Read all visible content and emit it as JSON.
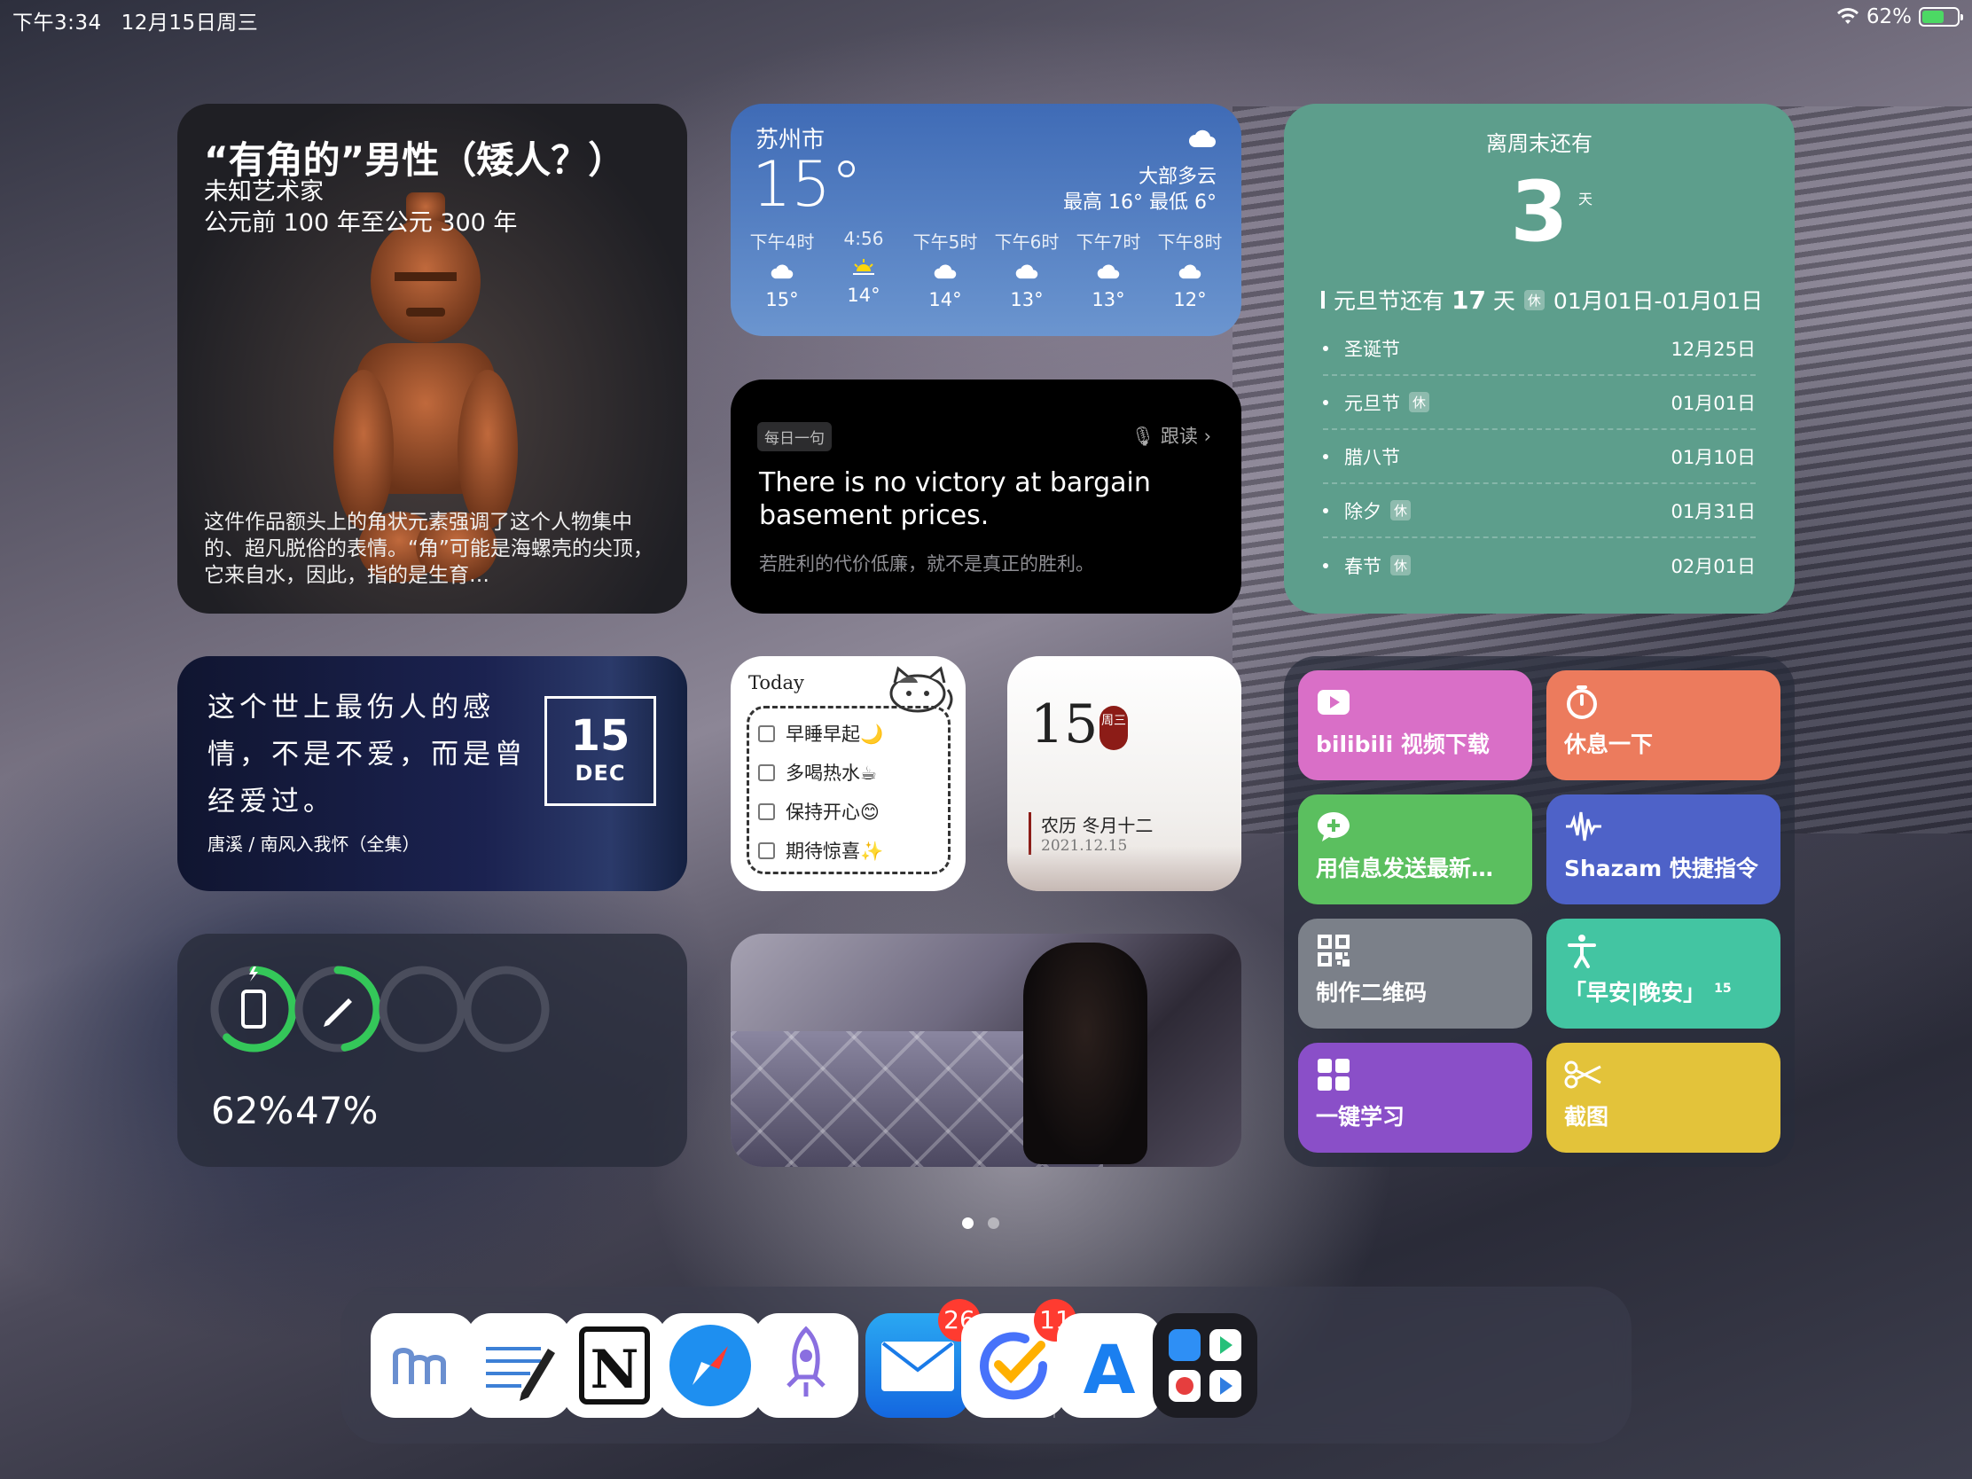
{
  "status_bar": {
    "time": "下午3:34",
    "date": "12月15日周三",
    "battery": "62%",
    "battery_level": 0.62
  },
  "museum": {
    "title": "“有角的”男性（矮人？）",
    "artist": "未知艺术家",
    "period": "公元前 100 年至公元 300 年",
    "description": "这件作品额头上的角状元素强调了这个人物集中的、超凡脱俗的表情。“角”可能是海螺壳的尖顶，它来自水，因此，指的是生育…"
  },
  "weather": {
    "city": "苏州市",
    "temp": "15°",
    "condition": "大部多云",
    "hilo": "最高 16° 最低 6°",
    "hours": [
      {
        "time": "下午4时",
        "icon": "cloud-icon",
        "temp": "15°"
      },
      {
        "time": "4:56",
        "icon": "sunset-icon",
        "temp": "14°"
      },
      {
        "time": "下午5时",
        "icon": "cloud-icon",
        "temp": "14°"
      },
      {
        "time": "下午6时",
        "icon": "cloud-icon",
        "temp": "13°"
      },
      {
        "time": "下午7时",
        "icon": "cloud-icon",
        "temp": "13°"
      },
      {
        "time": "下午8时",
        "icon": "cloud-icon",
        "temp": "12°"
      }
    ]
  },
  "quote": {
    "tag": "每日一句",
    "follow": "跟读 ›",
    "english": "There is no victory at bargain basement prices.",
    "chinese": "若胜利的代价低廉，就不是真正的胜利。"
  },
  "countdown": {
    "heading": "离周末还有",
    "days": "3",
    "unit": "天",
    "next_prefix": "元旦节还有",
    "next_days": "17",
    "next_suffix": "天",
    "holiday_tag": "休",
    "range": "01月01日-01月01日",
    "items": [
      {
        "name": "圣诞节",
        "date": "12月25日",
        "tag": ""
      },
      {
        "name": "元旦节",
        "date": "01月01日",
        "tag": "休"
      },
      {
        "name": "腊八节",
        "date": "01月10日",
        "tag": ""
      },
      {
        "name": "除夕",
        "date": "01月31日",
        "tag": "休"
      },
      {
        "name": "春节",
        "date": "02月01日",
        "tag": "休"
      }
    ]
  },
  "poem": {
    "text": "这个世上最伤人的感情，不是不爱，而是曾经爱过。",
    "source": "唐溪 / 南风入我怀（全集）",
    "day": "15",
    "month": "DEC"
  },
  "todo": {
    "title": "Today",
    "items": [
      "早睡早起🌙",
      "多喝热水☕",
      "保持开心😊",
      "期待惊喜✨"
    ]
  },
  "calendar": {
    "day": "15",
    "seal": "周三",
    "lunar": "农历 冬月十二",
    "date": "2021.12.15"
  },
  "batteries": [
    {
      "device": "ipad-icon",
      "value": 0.62,
      "label": "62%",
      "charging": true
    },
    {
      "device": "pencil-icon",
      "value": 0.47,
      "label": "47%",
      "charging": false
    },
    {
      "device": "",
      "value": 0,
      "label": "",
      "charging": false
    },
    {
      "device": "",
      "value": 0,
      "label": "",
      "charging": false
    }
  ],
  "shortcuts": [
    {
      "label": "bilibili 视频下载",
      "icon": "play-icon",
      "color": "#d96fc7"
    },
    {
      "label": "休息一下",
      "icon": "timer-icon",
      "color": "#ec7b5d"
    },
    {
      "label": "用信息发送最新…",
      "icon": "message-plus-icon",
      "color": "#5bbf5f"
    },
    {
      "label": "Shazam 快捷指令",
      "icon": "waveform-icon",
      "color": "#4e62c8"
    },
    {
      "label": "制作二维码",
      "icon": "qrcode-icon",
      "color": "#7b8089"
    },
    {
      "label": "「早安|晚安」",
      "icon": "accessibility-icon",
      "color": "#43c5a2",
      "superscript": "15"
    },
    {
      "label": "一键学习",
      "icon": "grid-icon",
      "color": "#8a4fc8"
    },
    {
      "label": "截图",
      "icon": "scissors-icon",
      "color": "#e3c33a"
    }
  ],
  "dock": {
    "apps": [
      {
        "name": "m",
        "icon": "marginnote-icon"
      },
      {
        "name": "",
        "icon": "notes-pen-icon"
      },
      {
        "name": "N",
        "icon": "notion-icon"
      },
      {
        "name": "",
        "icon": "safari-icon"
      },
      {
        "name": "",
        "icon": "rocket-icon"
      },
      {
        "name": "",
        "icon": "mail-icon",
        "badge": "26"
      },
      {
        "name": "",
        "icon": "ticktick-icon",
        "badge": "11"
      },
      {
        "name": "A",
        "icon": "app-store-icon"
      },
      {
        "name": "",
        "icon": "app-library-icon"
      }
    ]
  },
  "colors": {
    "countdown_bg": "#5d9e8c",
    "weather_top": "#3f6bb6",
    "ring_green": "#34c759",
    "badge_red": "#ff3b30"
  }
}
